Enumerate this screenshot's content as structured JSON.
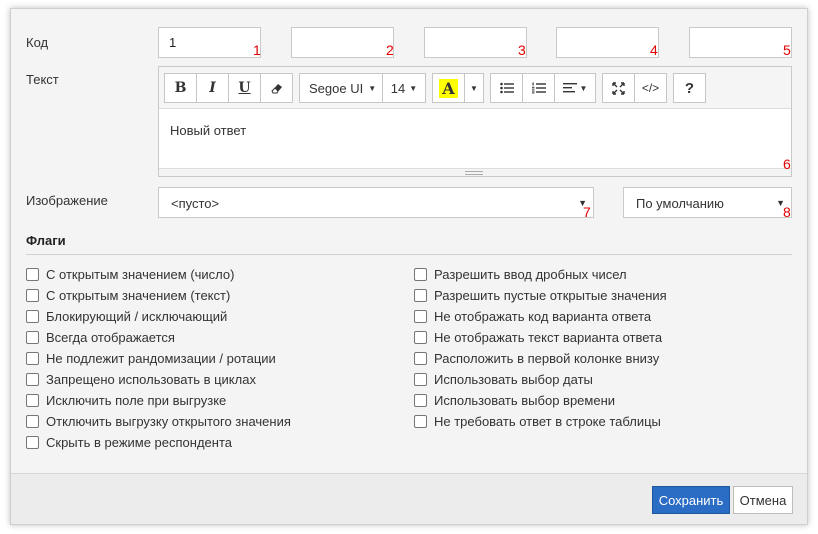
{
  "labels": {
    "code": "Код",
    "text": "Текст",
    "image": "Изображение",
    "flags": "Флаги"
  },
  "code_fields": [
    {
      "value": "1",
      "marker": "1"
    },
    {
      "value": "",
      "marker": "2"
    },
    {
      "value": "",
      "marker": "3"
    },
    {
      "value": "",
      "marker": "4"
    },
    {
      "value": "",
      "marker": "5"
    }
  ],
  "toolbar": {
    "bold": "B",
    "italic": "I",
    "underline": "U",
    "font_name": "Segoe UI",
    "font_size": "14",
    "color_letter": "A",
    "color_highlight": "#ffff00",
    "help": "?",
    "code_view": "</>"
  },
  "editor": {
    "content": "Новый ответ",
    "marker": "6"
  },
  "image_select": {
    "value": "<пусто>",
    "marker": "7"
  },
  "align_select": {
    "value": "По умолчанию",
    "marker": "8"
  },
  "flags_left": [
    "С открытым значением (число)",
    "С открытым значением (текст)",
    "Блокирующий / исключающий",
    "Всегда отображается",
    "Не подлежит рандомизации / ротации",
    "Запрещено использовать в циклах",
    "Исключить поле при выгрузке",
    "Отключить выгрузку открытого значения",
    "Скрыть в режиме респондента"
  ],
  "flags_right": [
    "Разрешить ввод дробных чисел",
    "Разрешить пустые открытые значения",
    "Не отображать код варианта ответа",
    "Не отображать текст варианта ответа",
    "Расположить в первой колонке внизу",
    "Использовать выбор даты",
    "Использовать выбор времени",
    "Не требовать ответ в строке таблицы"
  ],
  "footer": {
    "save": "Сохранить",
    "cancel": "Отмена"
  }
}
